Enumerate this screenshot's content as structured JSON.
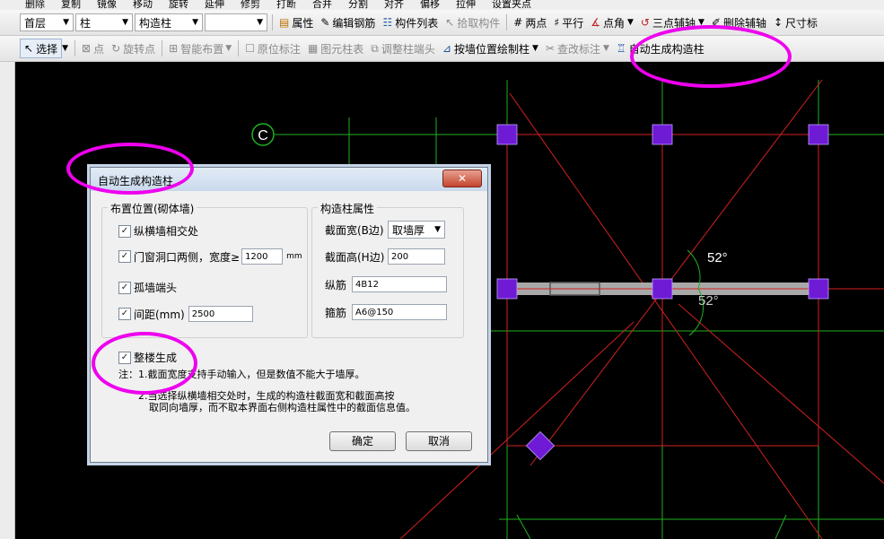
{
  "top_strip": [
    "删除",
    "复制",
    "镜像",
    "移动",
    "旋转",
    "延伸",
    "修剪",
    "打断",
    "合并",
    "分割",
    "对齐",
    "偏移",
    "拉伸",
    "设置夹点"
  ],
  "toolbar1": {
    "floor": "首层",
    "category": "柱",
    "type": "构造柱",
    "blank": "",
    "props": "属性",
    "edit_rebar": "编辑钢筋",
    "comp_list": "构件列表",
    "pick": "拾取构件",
    "two_point": "两点",
    "parallel": "平行",
    "angle_point": "点角",
    "three_point_axis": "三点辅轴",
    "delete_axis": "删除辅轴",
    "dim": "尺寸标"
  },
  "toolbar2": {
    "select": "选择",
    "point": "点",
    "rotate_point": "旋转点",
    "smart_layout": "智能布置",
    "origin_mark": "原位标注",
    "elem_table": "图元柱表",
    "adjust_end": "调整柱端头",
    "by_wall": "按墙位置绘制柱",
    "check": "查改标注",
    "auto_gen": "自动生成构造柱"
  },
  "canvas": {
    "axis_label": "C",
    "angle_labels": [
      "52°",
      "52°"
    ],
    "colors": {
      "bg": "#000000",
      "axis_red": "#d42020",
      "grid_green": "#1fb01f",
      "column": "#6f1bd6",
      "wall": "#a8a8a8"
    }
  },
  "dialog": {
    "title": "自动生成构造柱",
    "close": "✕",
    "group1_title": "布置位置(砌体墙)",
    "opt_cross": "纵横墙相交处",
    "opt_door": "门窗洞口两侧，宽度≥",
    "door_width": "1200",
    "door_unit": "mm",
    "opt_isolated": "孤墙端头",
    "opt_spacing": "间距(mm)",
    "spacing": "2500",
    "group2_title": "构造柱属性",
    "width_label": "截面宽(B边)",
    "width_value": "取墙厚",
    "height_label": "截面高(H边)",
    "height_value": "200",
    "long_label": "纵筋",
    "long_value": "4B12",
    "stirrup_label": "箍筋",
    "stirrup_value": "A6@150",
    "whole_building": "整楼生成",
    "note1": "注：1.截面宽度支持手动输入，但是数值不能大于墙厚。",
    "note2a": "2.当选择纵横墙相交处时，生成的构造柱截面宽和截面高按",
    "note2b": "取同向墙厚，而不取本界面右侧构造柱属性中的截面信息值。",
    "ok": "确定",
    "cancel": "取消"
  }
}
